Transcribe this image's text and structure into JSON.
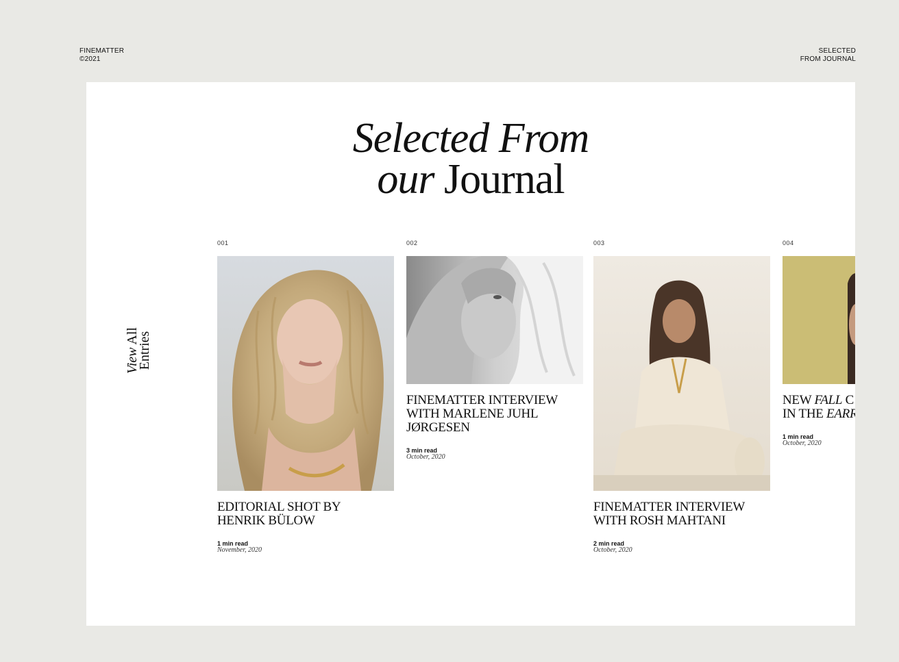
{
  "brand": {
    "name": "FINEMATTER",
    "year": "©2021"
  },
  "top_right": {
    "line1": "SELECTED",
    "line2": "FROM JOURNAL"
  },
  "headline": {
    "line1": "Selected From",
    "line2_italic": "our",
    "line2_rest": "Journal"
  },
  "view_all": {
    "italic": "View",
    "word2": "All",
    "word3": "Entries"
  },
  "cards": [
    {
      "num": "001",
      "title_line1": "EDITORIAL SHOT BY",
      "title_line2": "HENRIK BÜLOW",
      "read": "1 min read",
      "date": "November, 2020"
    },
    {
      "num": "002",
      "title_line1": "FINEMATTER INTERVIEW",
      "title_line2": "WITH MARLENE JUHL",
      "title_line3": "JØRGESEN",
      "read": "3 min read",
      "date": "October, 2020"
    },
    {
      "num": "003",
      "title_line1": "FINEMATTER INTERVIEW",
      "title_line2": "WITH ROSH MAHTANI",
      "read": "2 min read",
      "date": "October, 2020"
    },
    {
      "num": "004",
      "title_l1_a": "NEW",
      "title_l1_b": "FALL",
      "title_l1_c": "C",
      "title_l2_a": "IN THE",
      "title_l2_b": "EARR",
      "read": "1 min read",
      "date": "October, 2020"
    }
  ],
  "colors": {
    "background": "#e9e9e5",
    "panel": "#ffffff",
    "text": "#111111"
  }
}
